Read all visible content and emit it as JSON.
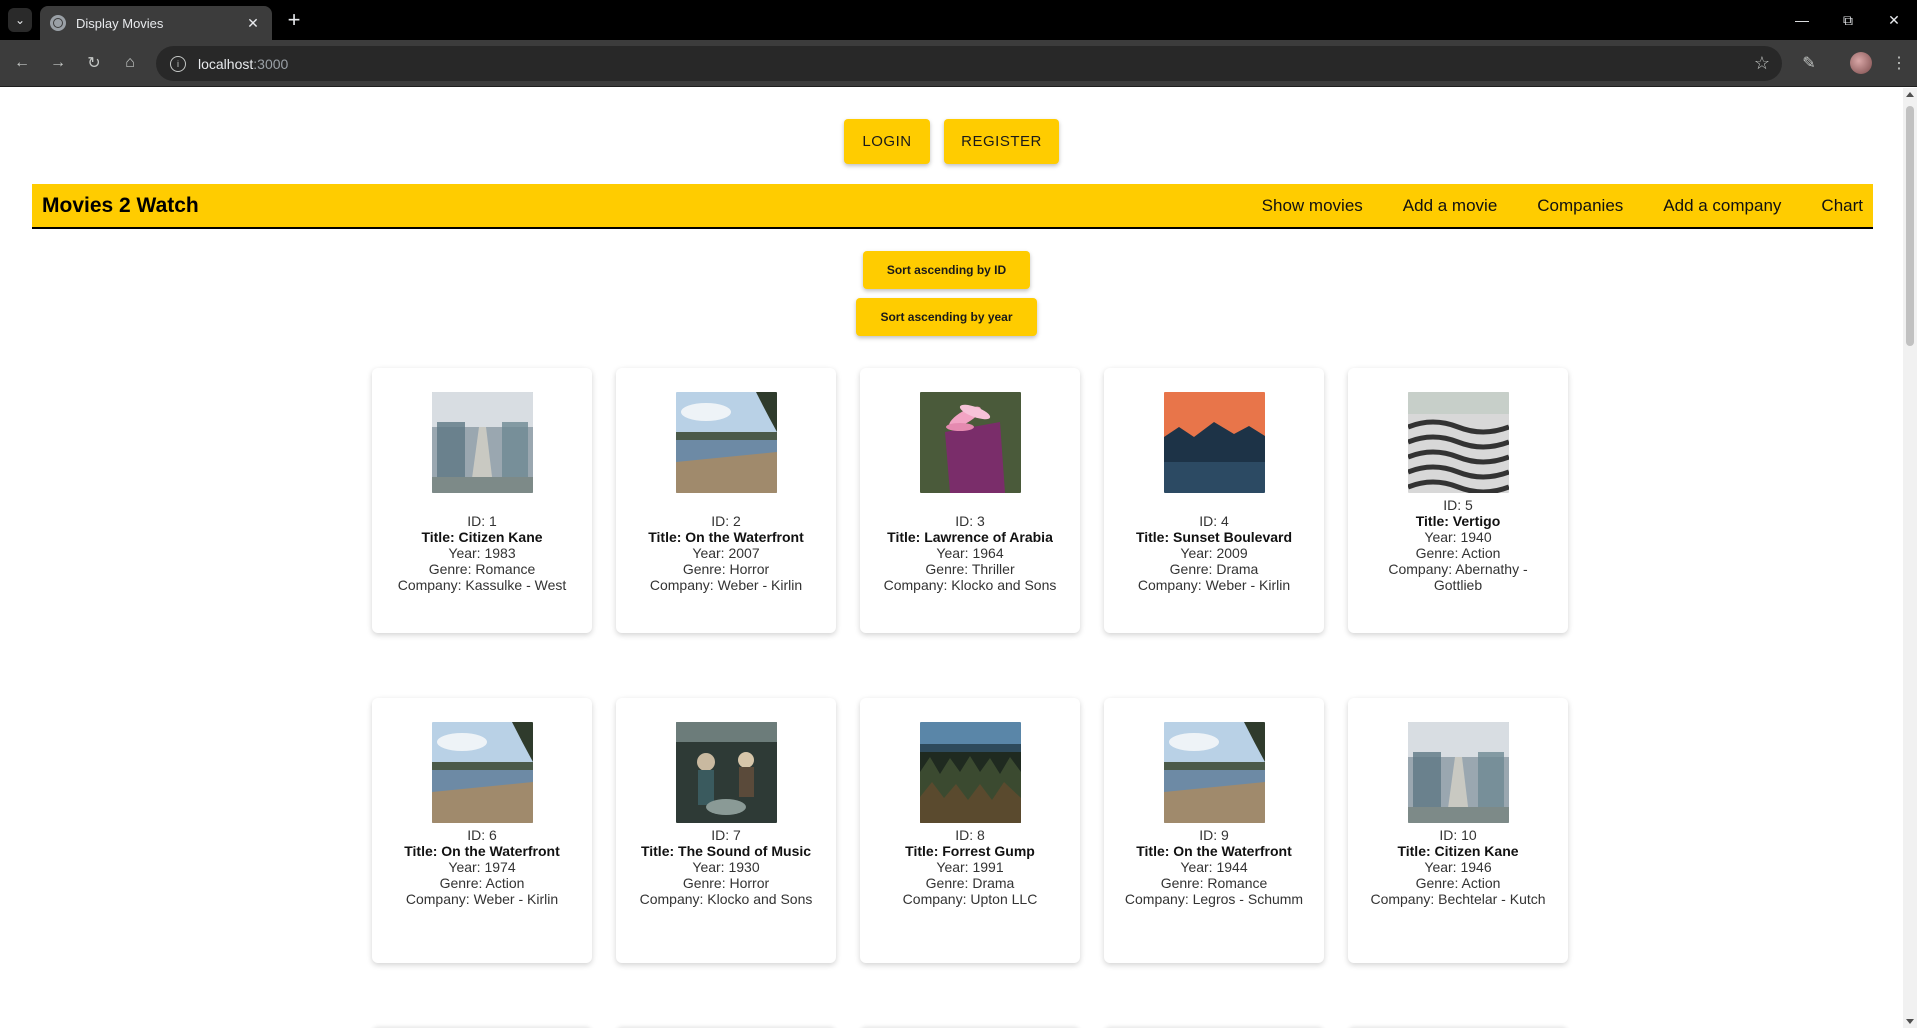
{
  "browser": {
    "tab_title": "Display Movies",
    "url_host": "localhost",
    "url_port": ":3000"
  },
  "auth": {
    "login": "LOGIN",
    "register": "REGISTER"
  },
  "navbar": {
    "brand": "Movies 2 Watch",
    "links": [
      "Show movies",
      "Add a movie",
      "Companies",
      "Add a company",
      "Chart"
    ]
  },
  "sort": {
    "by_id": "Sort ascending by ID",
    "by_year": "Sort ascending by year"
  },
  "colors": {
    "accent": "#ffcc00",
    "navbar_border": "#000000"
  },
  "movies": [
    {
      "id": "ID: 1",
      "title": "Title: Citizen Kane",
      "year": "Year: 1983",
      "genre": "Genre: Romance",
      "company": "Company: Kassulke - West",
      "image": "station-icon"
    },
    {
      "id": "ID: 2",
      "title": "Title: On the Waterfront",
      "year": "Year: 2007",
      "genre": "Genre: Horror",
      "company": "Company: Weber - Kirlin",
      "image": "dock-icon"
    },
    {
      "id": "ID: 3",
      "title": "Title: Lawrence of Arabia",
      "year": "Year: 1964",
      "genre": "Genre: Thriller",
      "company": "Company: Klocko and Sons",
      "image": "flower-book-icon"
    },
    {
      "id": "ID: 4",
      "title": "Title: Sunset Boulevard",
      "year": "Year: 2009",
      "genre": "Genre: Drama",
      "company": "Company: Weber - Kirlin",
      "image": "sunset-icon"
    },
    {
      "id": "ID: 5",
      "title": "Title: Vertigo",
      "year": "Year: 1940",
      "genre": "Genre: Action",
      "company": "Company: Abernathy - Gottlieb",
      "image": "wave-pavement-icon"
    },
    {
      "id": "ID: 6",
      "title": "Title: On the Waterfront",
      "year": "Year: 1974",
      "genre": "Genre: Action",
      "company": "Company: Weber - Kirlin",
      "image": "dock-icon"
    },
    {
      "id": "ID: 7",
      "title": "Title: The Sound of Music",
      "year": "Year: 1930",
      "genre": "Genre: Horror",
      "company": "Company: Klocko and Sons",
      "image": "band-icon"
    },
    {
      "id": "ID: 8",
      "title": "Title: Forrest Gump",
      "year": "Year: 1991",
      "genre": "Genre: Drama",
      "company": "Company: Upton LLC",
      "image": "forest-icon"
    },
    {
      "id": "ID: 9",
      "title": "Title: On the Waterfront",
      "year": "Year: 1944",
      "genre": "Genre: Romance",
      "company": "Company: Legros - Schumm",
      "image": "dock-icon"
    },
    {
      "id": "ID: 10",
      "title": "Title: Citizen Kane",
      "year": "Year: 1946",
      "genre": "Genre: Action",
      "company": "Company: Bechtelar - Kutch",
      "image": "station-icon"
    }
  ]
}
